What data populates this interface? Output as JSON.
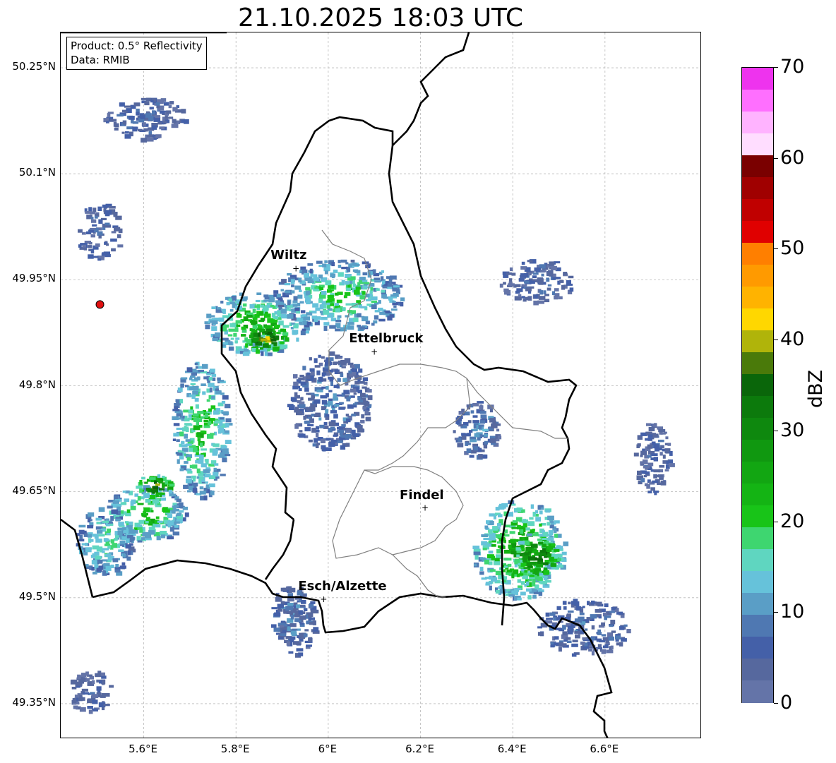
{
  "title": "21.10.2025 18:03 UTC",
  "info": {
    "product": "Product: 0.5° Reflectivity",
    "source": "Data: RMIB"
  },
  "lat_ticks": [
    "50.25°N",
    "50.1°N",
    "49.95°N",
    "49.8°N",
    "49.65°N",
    "49.5°N",
    "49.35°N"
  ],
  "lon_ticks": [
    "5.6°E",
    "5.8°E",
    "6°E",
    "6.2°E",
    "6.4°E",
    "6.6°E"
  ],
  "cities": [
    {
      "name": "Wiltz",
      "lon": 5.93,
      "lat": 49.966
    },
    {
      "name": "Ettelbruck",
      "lon": 6.1,
      "lat": 49.848
    },
    {
      "name": "Findel",
      "lon": 6.21,
      "lat": 49.627
    },
    {
      "name": "Esch/Alzette",
      "lon": 5.99,
      "lat": 49.498
    }
  ],
  "radar_site": {
    "lon": 5.505,
    "lat": 49.915,
    "color": "#e01010"
  },
  "map_extent": {
    "lon_min": 5.42,
    "lon_max": 6.81,
    "lat_min": 49.3,
    "lat_max": 50.3
  },
  "colorbar": {
    "label": "dBZ",
    "min": 0,
    "max": 70,
    "tick_labels": [
      "0",
      "10",
      "20",
      "30",
      "40",
      "50",
      "60",
      "70"
    ],
    "colors": [
      "#6474a8",
      "#56689e",
      "#4460a8",
      "#4f78b2",
      "#5a9ec6",
      "#66c2da",
      "#5fd6c0",
      "#3ed670",
      "#18c418",
      "#14b414",
      "#12a612",
      "#109810",
      "#0e880e",
      "#0c7a0c",
      "#0a660a",
      "#4a7a0a",
      "#b0b40a",
      "#ffd700",
      "#ffb300",
      "#ff9a00",
      "#ff7f00",
      "#e00000",
      "#c00000",
      "#a00000",
      "#7a0000",
      "#ffddff",
      "#ffb3ff",
      "#ff6fff",
      "#ee33ee"
    ]
  },
  "echo_cells": [
    {
      "lon": 5.84,
      "lat": 49.89,
      "rlon": 0.11,
      "rlat": 0.045,
      "dbz": 22
    },
    {
      "lon": 5.86,
      "lat": 49.87,
      "rlon": 0.05,
      "rlat": 0.02,
      "dbz": 37
    },
    {
      "lon": 6.02,
      "lat": 49.93,
      "rlon": 0.14,
      "rlat": 0.05,
      "dbz": 18
    },
    {
      "lon": 5.72,
      "lat": 49.74,
      "rlon": 0.06,
      "rlat": 0.1,
      "dbz": 20
    },
    {
      "lon": 5.6,
      "lat": 49.62,
      "rlon": 0.09,
      "rlat": 0.04,
      "dbz": 21
    },
    {
      "lon": 5.62,
      "lat": 49.66,
      "rlon": 0.04,
      "rlat": 0.015,
      "dbz": 36
    },
    {
      "lon": 5.51,
      "lat": 49.58,
      "rlon": 0.06,
      "rlat": 0.05,
      "dbz": 16
    },
    {
      "lon": 6.41,
      "lat": 49.57,
      "rlon": 0.1,
      "rlat": 0.07,
      "dbz": 24
    },
    {
      "lon": 6.45,
      "lat": 49.56,
      "rlon": 0.05,
      "rlat": 0.035,
      "dbz": 33
    },
    {
      "lon": 6.0,
      "lat": 49.78,
      "rlon": 0.09,
      "rlat": 0.07,
      "dbz": 8
    },
    {
      "lon": 6.45,
      "lat": 49.95,
      "rlon": 0.08,
      "rlat": 0.03,
      "dbz": 6
    },
    {
      "lon": 6.55,
      "lat": 49.46,
      "rlon": 0.1,
      "rlat": 0.04,
      "dbz": 7
    },
    {
      "lon": 5.92,
      "lat": 49.47,
      "rlon": 0.05,
      "rlat": 0.05,
      "dbz": 8
    },
    {
      "lon": 5.6,
      "lat": 50.18,
      "rlon": 0.09,
      "rlat": 0.03,
      "dbz": 6
    },
    {
      "lon": 5.5,
      "lat": 50.02,
      "rlon": 0.05,
      "rlat": 0.04,
      "dbz": 5
    },
    {
      "lon": 6.32,
      "lat": 49.74,
      "rlon": 0.05,
      "rlat": 0.04,
      "dbz": 9
    },
    {
      "lon": 5.48,
      "lat": 49.37,
      "rlon": 0.05,
      "rlat": 0.03,
      "dbz": 5
    },
    {
      "lon": 6.7,
      "lat": 49.7,
      "rlon": 0.04,
      "rlat": 0.05,
      "dbz": 6
    }
  ]
}
